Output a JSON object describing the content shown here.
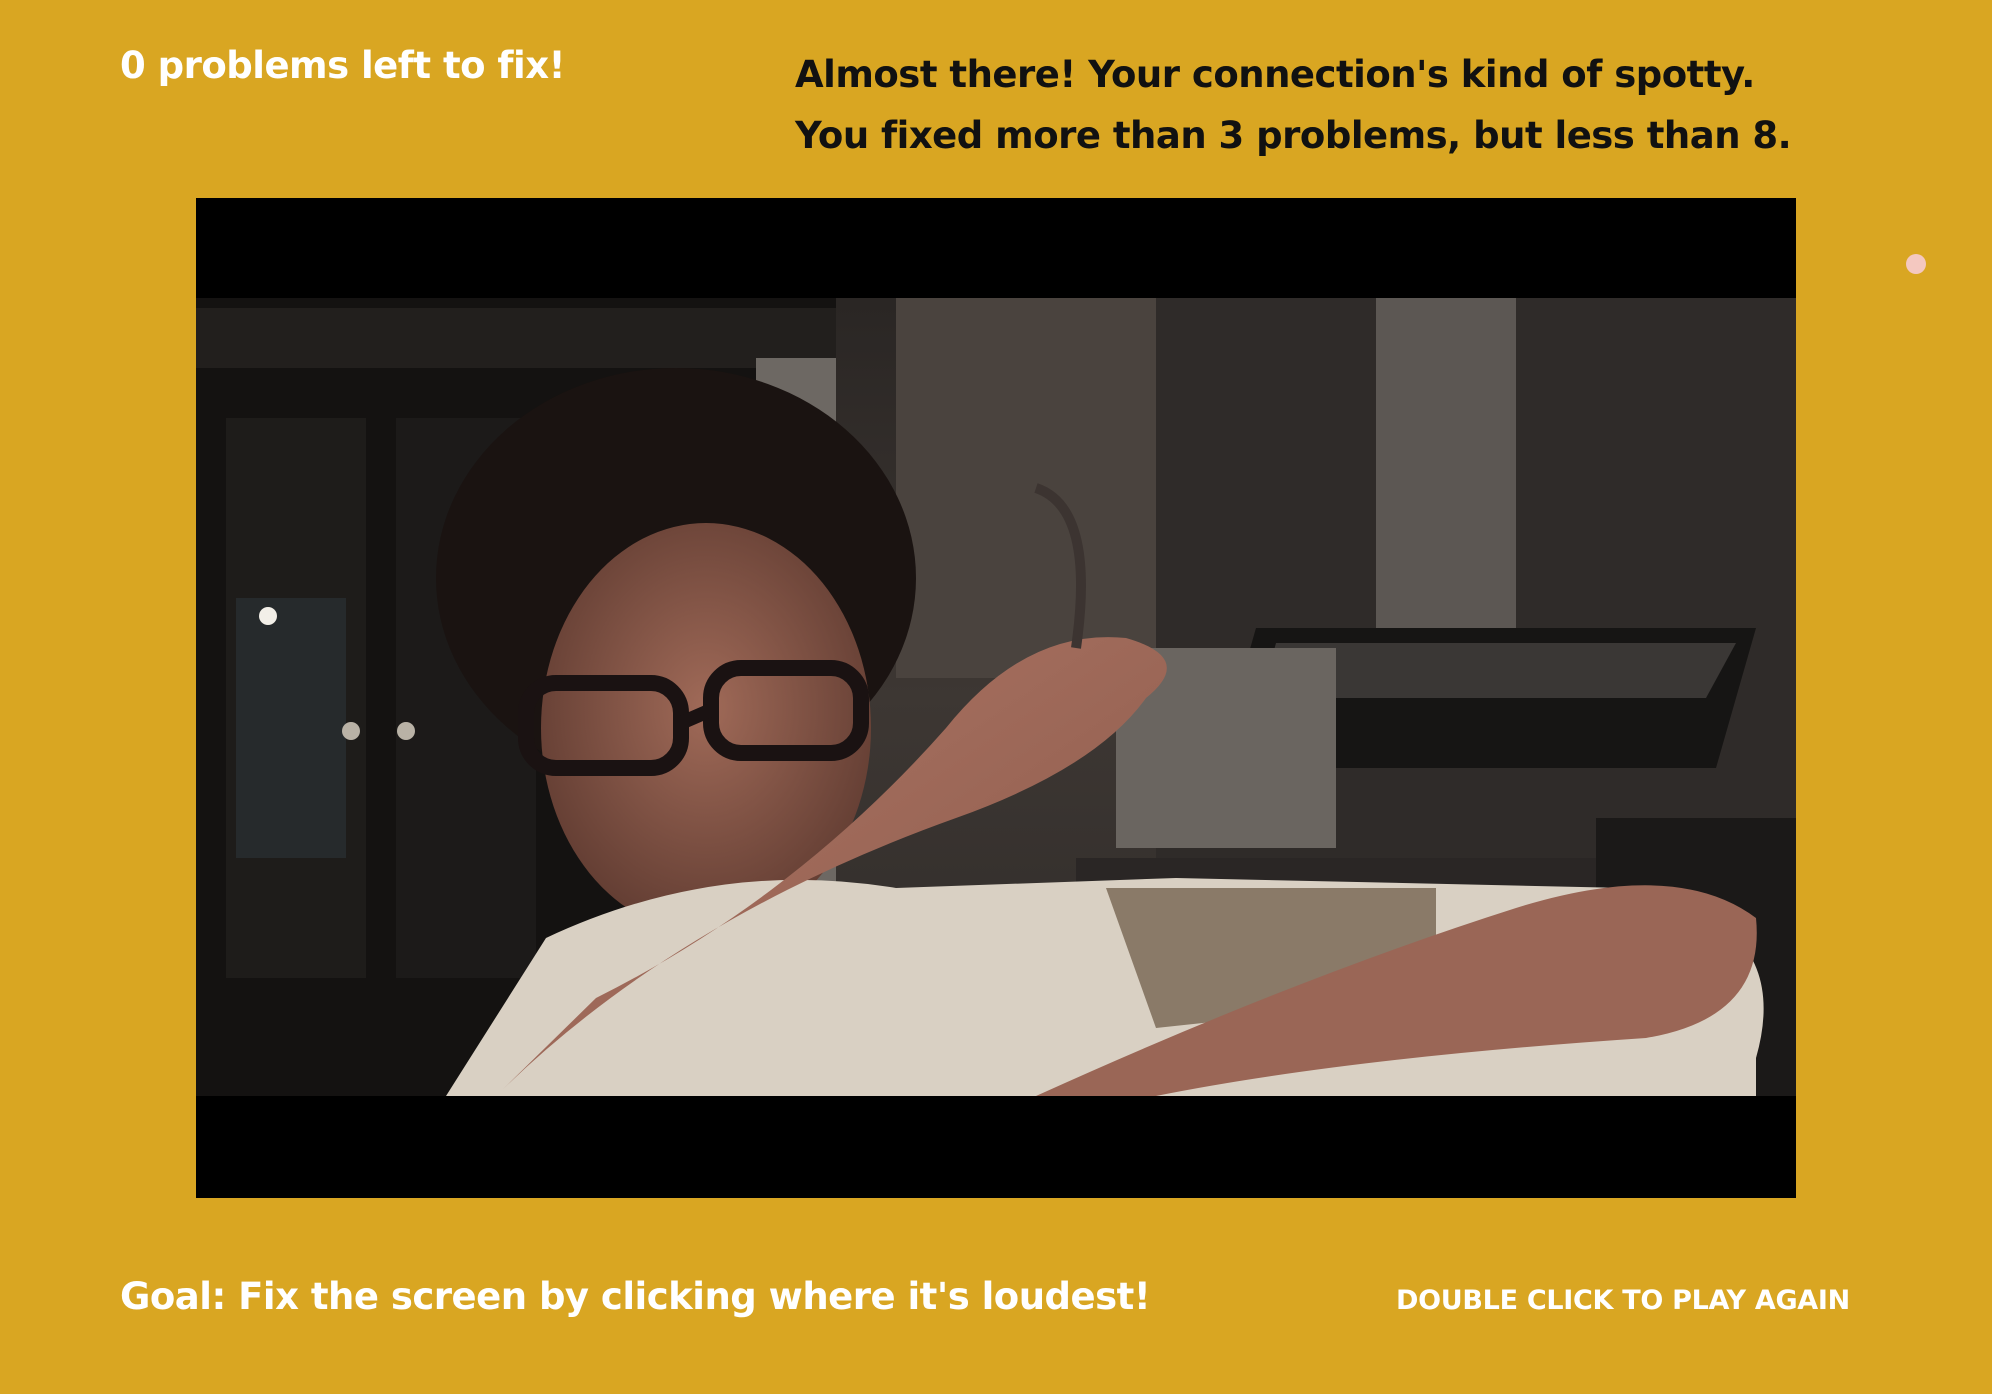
{
  "game": {
    "problems_left_text": "0 problems left to fix!",
    "result_message": {
      "line1": "Almost there! Your connection's kind of spotty.",
      "line2": "You fixed more than 3 problems, but less than 8."
    },
    "goal_text": "Goal: Fix the screen by clicking where it's loudest!",
    "replay_text": "DOUBLE CLICK TO PLAY AGAIN"
  },
  "colors": {
    "background": "#D9A622",
    "primary_text": "#FFFFFF",
    "message_text": "#111111",
    "video_bars": "#000000",
    "cursor_dot": "#F4C8C0"
  }
}
